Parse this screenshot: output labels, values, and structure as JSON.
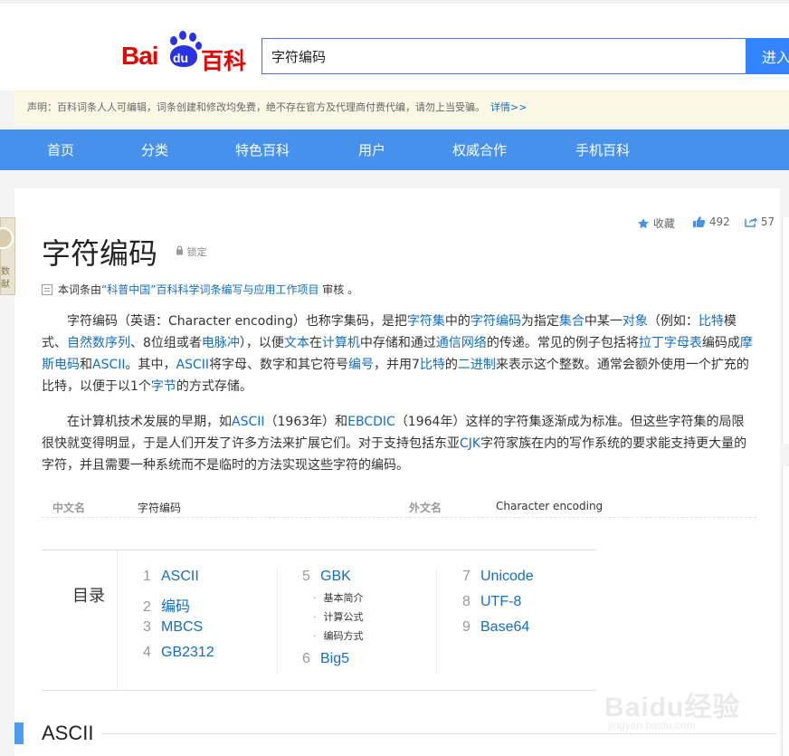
{
  "header": {
    "logo_bai": "Bai",
    "logo_du": "du",
    "logo_baike": "百科",
    "search_value": "字符编码",
    "search_button": "进入"
  },
  "notice": {
    "text": "声明：百科词条人人可编辑，词条创建和修改均免费，绝不存在官方及代理商付费代编，请勿上当受骗。",
    "link": "详情>>"
  },
  "nav": {
    "items": [
      "首页",
      "分类",
      "特色百科",
      "用户",
      "权威合作",
      "手机百科"
    ]
  },
  "side_left": {
    "line1": "数",
    "line2": "献"
  },
  "actions": {
    "favorite_label": "收藏",
    "like_count": "492",
    "share_count": "57"
  },
  "article": {
    "title": "字符编码",
    "lock_label": "锁定",
    "review_prefix": "本词条由",
    "review_link": "“科普中国”百科科学词条编写与应用工作项目",
    "review_suffix": " 审核 。"
  },
  "para1": {
    "s1": "字符编码（英语：Character encoding）也称字集码，是把",
    "l1": "字符集",
    "s2": "中的",
    "l2": "字符编码",
    "s3": "为指定",
    "l3": "集合",
    "s4": "中某一",
    "l4": "对象",
    "s5": "（例如：",
    "l5": "比特",
    "s6": "模式、",
    "l6": "自然数序列",
    "s7": "、8位组或者",
    "l7": "电脉冲",
    "s8": "），以便",
    "l8": "文本",
    "s9": "在",
    "l9": "计算机",
    "s10": "中存储和通过",
    "l10": "通信网络",
    "s11": "的传递。常见的例子包括将",
    "l11": "拉丁字母表",
    "s12": "编码成",
    "l12": "摩斯电码",
    "s13": "和",
    "l13": "ASCII",
    "s14": "。其中，",
    "l14": "ASCII",
    "s15": "将字母、数字和其它符号",
    "l15": "编号",
    "s16": "，并用7",
    "l16": "比特",
    "s17": "的",
    "l17": "二进制",
    "s18": "来表示这个整数。通常会额外使用一个扩充的比特，以便于以1个",
    "l18": "字节",
    "s19": "的方式存储。"
  },
  "para2": {
    "s1": "在计算机技术发展的早期，如",
    "l1": "ASCII",
    "s2": "（1963年）和",
    "l2": "EBCDIC",
    "s3": "（1964年）这样的字符集逐渐成为标准。但这些字符集的局限很快就变得明显，于是人们开发了许多方法来扩展它们。对于支持包括东亚",
    "l3": "CJK",
    "s4": "字符家族在内的写作系统的要求能支持更大量的字符，并且需要一种系统而不是临时的方法实现这些字符的编码。"
  },
  "basic_info": {
    "k1": "中文名",
    "v1": "字符编码",
    "k2": "外文名",
    "v2": "Character encoding"
  },
  "toc": {
    "label": "目录",
    "items": [
      {
        "num": "1",
        "title": "ASCII"
      },
      {
        "num": "2",
        "title": "编码"
      },
      {
        "num": "3",
        "title": "MBCS"
      },
      {
        "num": "4",
        "title": "GB2312"
      },
      {
        "num": "5",
        "title": "GBK"
      },
      {
        "num": "6",
        "title": "Big5"
      },
      {
        "num": "7",
        "title": "Unicode"
      },
      {
        "num": "8",
        "title": "UTF-8"
      },
      {
        "num": "9",
        "title": "Base64"
      }
    ],
    "subs": [
      "基本简介",
      "计算公式",
      "编码方式"
    ]
  },
  "section": {
    "heading": "ASCII"
  },
  "watermark": {
    "brand": "Baidu经验",
    "url": "jingyan.baidu.com"
  },
  "colors": {
    "nav": "#4591eb",
    "link": "#136ec2",
    "brand_red": "#e10601",
    "brand_blue": "#2932e1"
  }
}
